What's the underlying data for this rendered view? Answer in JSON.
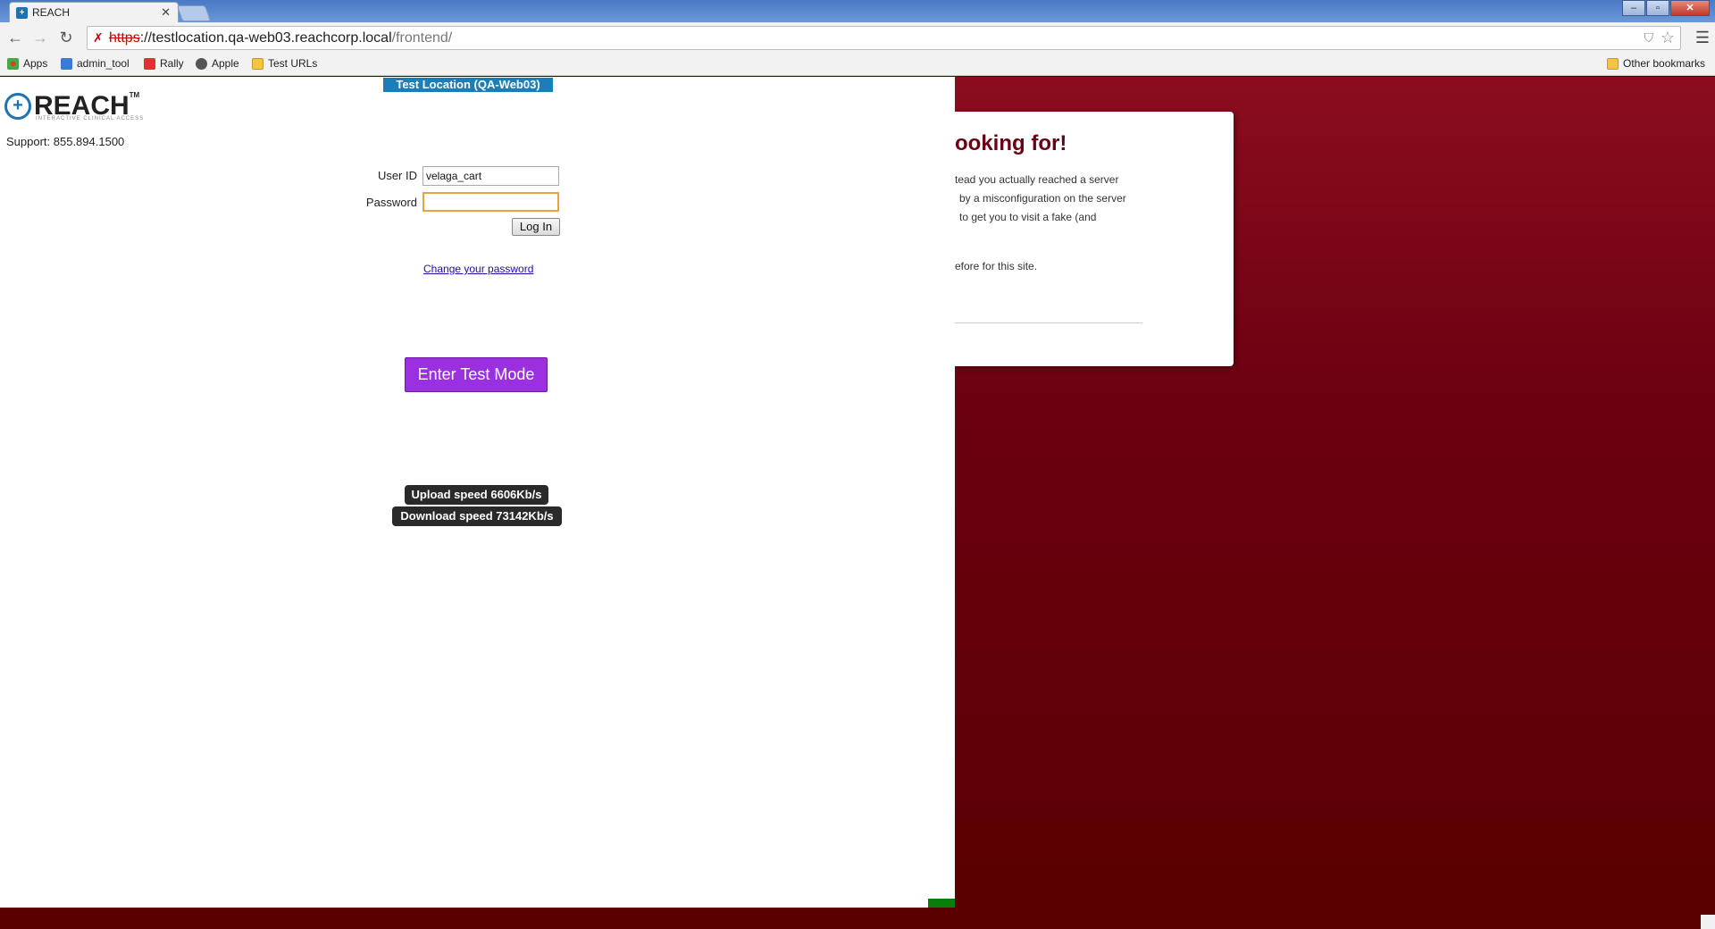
{
  "browser": {
    "tab_title": "REACH",
    "tab_favicon": "+",
    "tab_close": "✕",
    "url_scheme": "https",
    "url_host": "://testlocation.qa-web03.reachcorp.local",
    "url_path": "/frontend/",
    "bookmarks": [
      {
        "label": "Apps",
        "icon": "apps-icon"
      },
      {
        "label": "admin_tool",
        "icon": "admin-tool-icon"
      },
      {
        "label": "Rally",
        "icon": "rally-icon"
      },
      {
        "label": "Apple",
        "icon": "apple-icon"
      },
      {
        "label": "Test URLs",
        "icon": "folder-icon"
      }
    ],
    "other_bookmarks": "Other bookmarks"
  },
  "page": {
    "env_banner": "Test Location (QA-Web03)",
    "logo_text": "REACH",
    "logo_tm": "TM",
    "logo_sub": "INTERACTIVE CLINICAL ACCESS",
    "support": "Support: 855.894.1500",
    "user_id_label": "User ID",
    "user_id_value": "velaga_cart",
    "password_label": "Password",
    "password_value": "",
    "login_button": "Log In",
    "change_password": "Change your password",
    "test_mode_button": "Enter Test Mode",
    "upload_speed": "Upload speed 6606Kb/s",
    "download_speed": "Download speed 73142Kb/s"
  },
  "error_page": {
    "heading": "ooking for!",
    "lines": [
      "tead you actually reached a server",
      "by a misconfiguration on the server",
      "to get you to visit a fake (and",
      "efore for this site."
    ]
  },
  "colors": {
    "brand": "#1b73b5",
    "test_mode": "#9b30e0",
    "error_bg": "#6b0010"
  }
}
